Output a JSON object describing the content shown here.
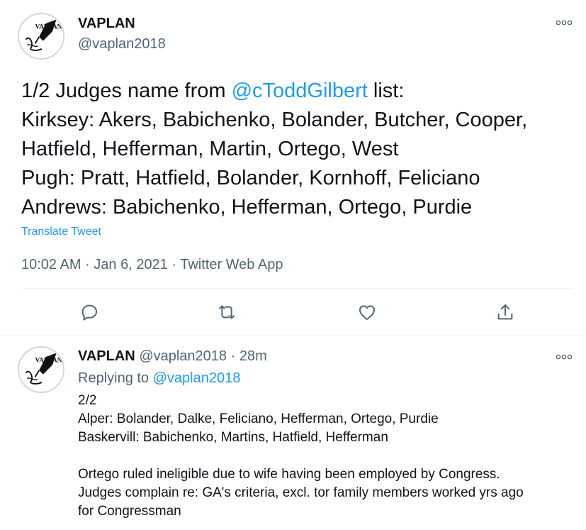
{
  "main_tweet": {
    "display_name": "VAPLAN",
    "handle": "@vaplan2018",
    "avatar_icon": "fountain-pen-logo-icon",
    "avatar_text": "VAPLAN",
    "more_icon": "more-dots-icon",
    "text_prefix": "1/2 Judges name from ",
    "mention": "@cTodd​Gilbert",
    "text_after_mention": " list:",
    "text_body": "Kirksey: Akers, Babichenko, Bolander, Butcher, Cooper,\nHatfield, Hefferman, Martin, Ortego, West\nPugh: Pratt, Hatfield, Bolander, Kornhoff, Feliciano\nAndrews: Babichenko, Hefferman, Ortego, Purdie",
    "translate_label": "Translate Tweet",
    "meta": "10:02 AM · Jan 6, 2021 · Twitter Web App",
    "actions": {
      "reply_icon": "reply-icon",
      "retweet_icon": "retweet-icon",
      "like_icon": "heart-icon",
      "share_icon": "share-icon"
    }
  },
  "reply_tweet": {
    "display_name": "VAPLAN",
    "handle": "@vaplan2018",
    "separator": " · ",
    "time": "28m",
    "replying_prefix": "Replying to ",
    "replying_to": "@vaplan2018",
    "text": "2/2\nAlper: Bolander, Dalke, Feliciano, Hefferman, Ortego, Purdie\nBaskervill: Babichenko, Martins, Hatfield, Hefferman\n\nOrtego ruled ineligible due to wife having been employed by Congress.\nJudges complain re: GA's criteria, excl. tor family members worked yrs ago\nfor Congressman"
  },
  "colors": {
    "accent": "#1d9bf0",
    "secondary_text": "#536471",
    "primary_text": "#0f1419",
    "divider": "#eff3f4"
  }
}
